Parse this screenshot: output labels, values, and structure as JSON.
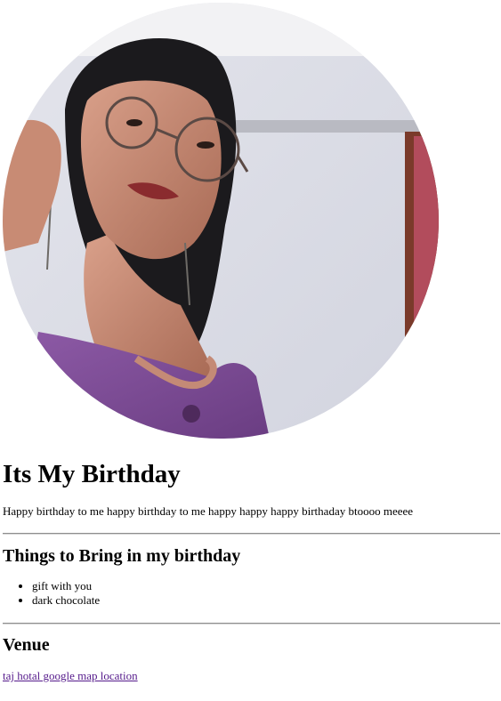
{
  "photo": {
    "icon": "profile-photo",
    "shape": "circle"
  },
  "heading": "Its My Birthday",
  "intro_text": "Happy birthday to me happy birthday to me happy happy happy birthaday btoooo meeee",
  "bring_section": {
    "title": "Things to Bring in my birthday",
    "items": [
      {
        "label": "gift with you"
      },
      {
        "label": "dark chocolate"
      }
    ]
  },
  "venue_section": {
    "title": "Venue",
    "link_text": "taj hotal google map location"
  },
  "colors": {
    "visited_link": "#551a8b",
    "rule": "#8e8e8e"
  }
}
